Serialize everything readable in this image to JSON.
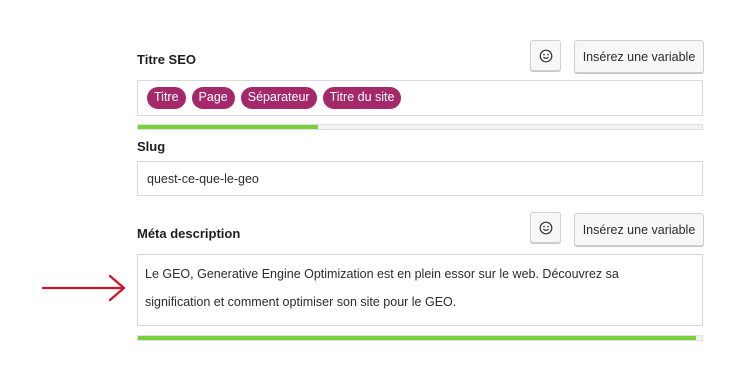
{
  "seo_title": {
    "label": "Titre SEO",
    "insert_variable_label": "Insérez une variable",
    "chips": [
      "Titre",
      "Page",
      "Séparateur",
      "Titre du site"
    ],
    "progress": 0.32,
    "progress_color": "#7ad03a"
  },
  "slug": {
    "label": "Slug",
    "value": "quest-ce-que-le-geo"
  },
  "meta_description": {
    "label": "Méta description",
    "insert_variable_label": "Insérez une variable",
    "line1": "Le GEO, Generative Engine Optimization est en plein essor sur le web. Découvrez sa",
    "line2": "signification et comment optimiser son site pour le GEO.",
    "progress": 0.99,
    "progress_color": "#7ad03a"
  },
  "colors": {
    "chip": "#a4286a",
    "arrow": "#d0112b"
  },
  "icons": {
    "emoji": "smiley-icon",
    "arrow": "red-arrow-icon"
  }
}
